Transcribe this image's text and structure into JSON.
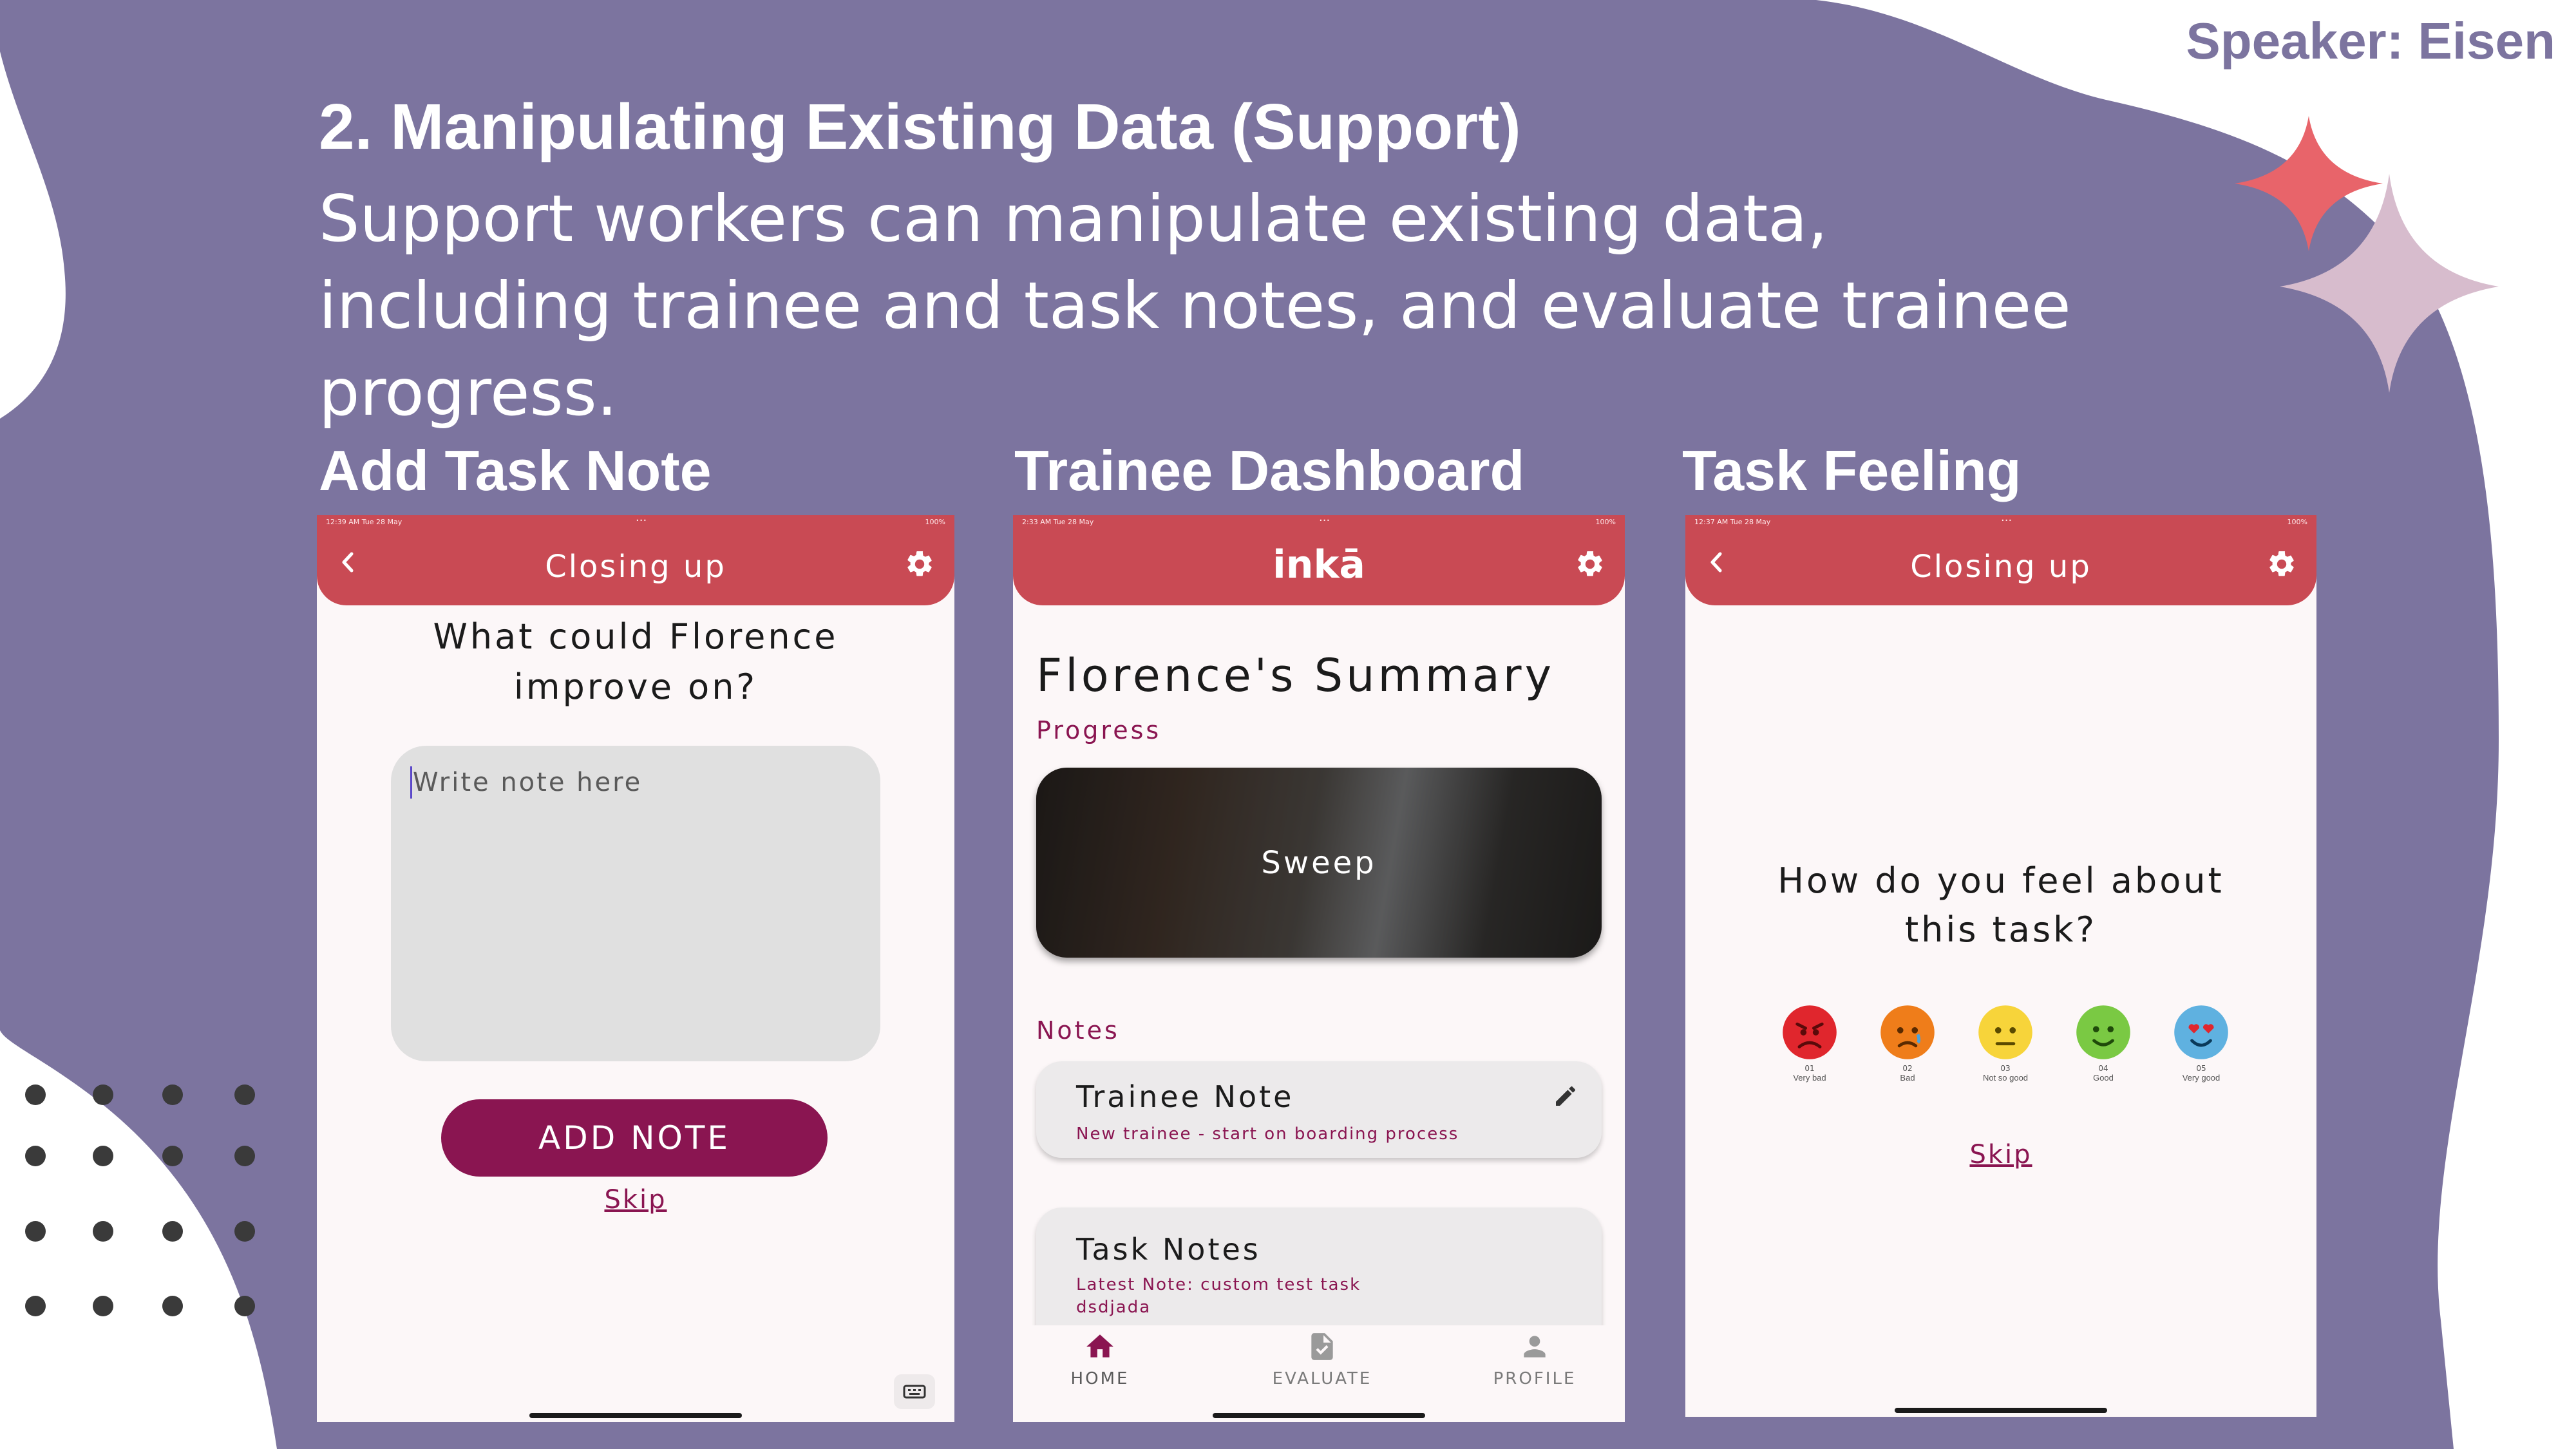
{
  "slide": {
    "speaker": "Speaker: Eisen",
    "title": "2. Manipulating Existing Data (Support)",
    "subtitle": "Support workers can manipulate existing data, including trainee and task notes, and evaluate trainee progress."
  },
  "sections": {
    "add_task_note": "Add Task Note",
    "trainee_dashboard": "Trainee Dashboard",
    "task_feeling": "Task Feeling"
  },
  "colors": {
    "slide_purple": "#7c749f",
    "app_bar_red": "#c94a54",
    "primary_maroon": "#8a1551",
    "star_coral": "#e8646a",
    "star_pink": "#d7bccd"
  },
  "screen1": {
    "status_time": "12:39 AM  Tue 28 May",
    "status_battery": "100%",
    "app_title": "Closing up",
    "question_line1": "What could Florence",
    "question_line2": "improve on?",
    "note_placeholder": "Write note here",
    "add_note_label": "ADD NOTE",
    "skip_label": "Skip"
  },
  "screen2": {
    "status_time": "2:33 AM  Tue 28 May",
    "status_battery": "100%",
    "brand": "inkā",
    "summary_title": "Florence's Summary",
    "progress_label": "Progress",
    "progress_card_label": "Sweep",
    "notes_label": "Notes",
    "trainee_note_title": "Trainee Note",
    "trainee_note_text": "New trainee - start on boarding process",
    "task_notes_title": "Task Notes",
    "task_notes_line1": "Latest Note: custom test task",
    "task_notes_line2": "dsdjada",
    "nav": {
      "home": "HOME",
      "evaluate": "EVALUATE",
      "profile": "PROFILE"
    }
  },
  "screen3": {
    "status_time": "12:37 AM  Tue 28 May",
    "status_battery": "100%",
    "app_title": "Closing up",
    "question_line1": "How do you feel about",
    "question_line2": "this task?",
    "skip_label": "Skip",
    "feelings": [
      {
        "num": "01",
        "label": "Very bad",
        "color": "#e0262d",
        "face": "very-bad-face-icon"
      },
      {
        "num": "02",
        "label": "Bad",
        "color": "#ef7d1a",
        "face": "bad-face-icon"
      },
      {
        "num": "03",
        "label": "Not so good",
        "color": "#f7d43a",
        "face": "not-so-good-face-icon"
      },
      {
        "num": "04",
        "label": "Good",
        "color": "#7ac943",
        "face": "good-face-icon"
      },
      {
        "num": "05",
        "label": "Very good",
        "color": "#5fb1e0",
        "face": "very-good-face-icon"
      }
    ]
  }
}
